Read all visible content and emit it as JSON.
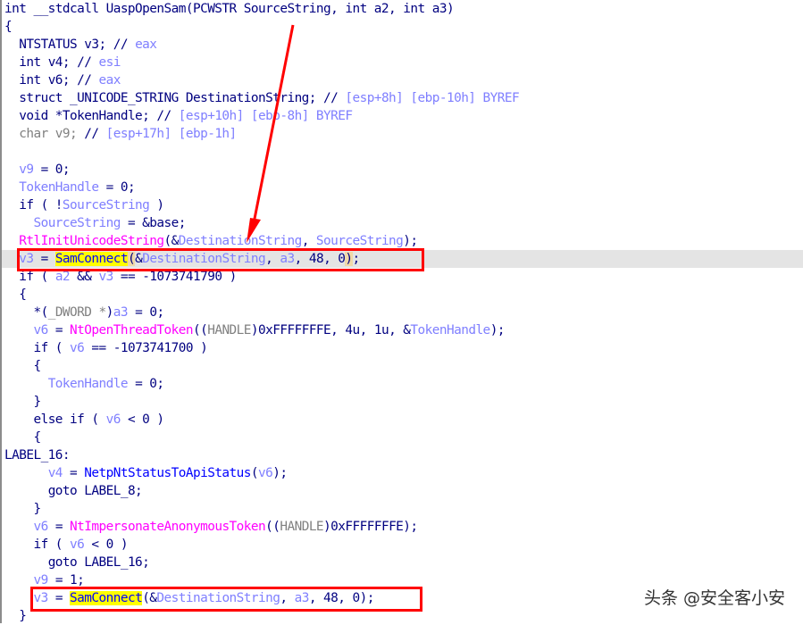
{
  "window": {
    "type": "IDA Pro pseudocode view",
    "function_signature": "int __stdcall UaspOpenSam(PCWSTR SourceString, int a2, int a3)"
  },
  "colors": {
    "keyword": "#000080",
    "variable": "#7f7fff",
    "function_import": "#ff00ff",
    "function_local": "#0000ff",
    "highlight_line": "#e4e4e4",
    "selected_word": "#ffff00",
    "annotation": "#ff0000"
  },
  "lines": [
    {
      "indent": 0,
      "tokens": [
        {
          "c": "t-kw",
          "t": "int __stdcall UaspOpenSam(PCWSTR SourceString, int a2, int a3)"
        }
      ]
    },
    {
      "indent": 0,
      "tokens": [
        {
          "c": "t-kw",
          "t": "{"
        }
      ]
    },
    {
      "indent": 2,
      "tokens": [
        {
          "c": "t-kw",
          "t": "NTSTATUS v3; // "
        },
        {
          "c": "t-cmt",
          "t": "eax"
        }
      ]
    },
    {
      "indent": 2,
      "tokens": [
        {
          "c": "t-kw",
          "t": "int v4; // "
        },
        {
          "c": "t-cmt",
          "t": "esi"
        }
      ]
    },
    {
      "indent": 2,
      "tokens": [
        {
          "c": "t-kw",
          "t": "int v6; // "
        },
        {
          "c": "t-cmt",
          "t": "eax"
        }
      ]
    },
    {
      "indent": 2,
      "tokens": [
        {
          "c": "t-kw",
          "t": "struct _UNICODE_STRING DestinationString; // "
        },
        {
          "c": "t-cmt",
          "t": "[esp+8h] [ebp-10h] BYREF"
        }
      ]
    },
    {
      "indent": 2,
      "tokens": [
        {
          "c": "t-kw",
          "t": "void *TokenHandle; // "
        },
        {
          "c": "t-cmt",
          "t": "[esp+10h] [ebp-8h] BYREF"
        }
      ]
    },
    {
      "indent": 2,
      "tokens": [
        {
          "c": "t-gray",
          "t": "char v9; "
        },
        {
          "c": "t-kw",
          "t": "// "
        },
        {
          "c": "t-cmt",
          "t": "[esp+17h] [ebp-1h]"
        }
      ]
    },
    {
      "indent": 0,
      "tokens": []
    },
    {
      "indent": 2,
      "tokens": [
        {
          "c": "t-var",
          "t": "v9"
        },
        {
          "c": "t-kw",
          "t": " = 0;"
        }
      ]
    },
    {
      "indent": 2,
      "tokens": [
        {
          "c": "t-var",
          "t": "TokenHandle"
        },
        {
          "c": "t-kw",
          "t": " = 0;"
        }
      ]
    },
    {
      "indent": 2,
      "tokens": [
        {
          "c": "t-kw",
          "t": "if ( !"
        },
        {
          "c": "t-var",
          "t": "SourceString"
        },
        {
          "c": "t-kw",
          "t": " )"
        }
      ]
    },
    {
      "indent": 4,
      "tokens": [
        {
          "c": "t-var",
          "t": "SourceString"
        },
        {
          "c": "t-kw",
          "t": " = &base;"
        }
      ]
    },
    {
      "indent": 2,
      "tokens": [
        {
          "c": "t-fn",
          "t": "RtlInitUnicodeString"
        },
        {
          "c": "t-kw",
          "t": "(&"
        },
        {
          "c": "t-var",
          "t": "DestinationString"
        },
        {
          "c": "t-kw",
          "t": ", "
        },
        {
          "c": "t-var",
          "t": "SourceString"
        },
        {
          "c": "t-kw",
          "t": ");"
        }
      ]
    },
    {
      "indent": 2,
      "hl": true,
      "tokens": [
        {
          "c": "t-var",
          "t": "v3"
        },
        {
          "c": "t-kw",
          "t": " = "
        },
        {
          "c": "t-sel",
          "t": "SamConnect"
        },
        {
          "c": "t-kw t-paren",
          "t": "("
        },
        {
          "c": "t-kw",
          "t": "&"
        },
        {
          "c": "t-var",
          "t": "DestinationString"
        },
        {
          "c": "t-kw",
          "t": ", "
        },
        {
          "c": "t-var",
          "t": "a3"
        },
        {
          "c": "t-kw",
          "t": ", 48, 0"
        },
        {
          "c": "t-kw t-paren",
          "t": ")"
        },
        {
          "c": "t-kw",
          "t": ";"
        }
      ]
    },
    {
      "indent": 2,
      "tokens": [
        {
          "c": "t-kw",
          "t": "if ( "
        },
        {
          "c": "t-var",
          "t": "a2"
        },
        {
          "c": "t-kw",
          "t": " && "
        },
        {
          "c": "t-var",
          "t": "v3"
        },
        {
          "c": "t-kw",
          "t": " == -1073741790 )"
        }
      ]
    },
    {
      "indent": 2,
      "tokens": [
        {
          "c": "t-kw",
          "t": "{"
        }
      ]
    },
    {
      "indent": 4,
      "tokens": [
        {
          "c": "t-kw",
          "t": "*("
        },
        {
          "c": "t-gray",
          "t": "_DWORD *"
        },
        {
          "c": "t-kw",
          "t": ")"
        },
        {
          "c": "t-var",
          "t": "a3"
        },
        {
          "c": "t-kw",
          "t": " = 0;"
        }
      ]
    },
    {
      "indent": 4,
      "tokens": [
        {
          "c": "t-var",
          "t": "v6"
        },
        {
          "c": "t-kw",
          "t": " = "
        },
        {
          "c": "t-fn",
          "t": "NtOpenThreadToken"
        },
        {
          "c": "t-kw",
          "t": "(("
        },
        {
          "c": "t-gray",
          "t": "HANDLE"
        },
        {
          "c": "t-kw",
          "t": ")0xFFFFFFFE, 4u, 1u, &"
        },
        {
          "c": "t-var",
          "t": "TokenHandle"
        },
        {
          "c": "t-kw",
          "t": ");"
        }
      ]
    },
    {
      "indent": 4,
      "tokens": [
        {
          "c": "t-kw",
          "t": "if ( "
        },
        {
          "c": "t-var",
          "t": "v6"
        },
        {
          "c": "t-kw",
          "t": " == -1073741700 )"
        }
      ]
    },
    {
      "indent": 4,
      "tokens": [
        {
          "c": "t-kw",
          "t": "{"
        }
      ]
    },
    {
      "indent": 6,
      "tokens": [
        {
          "c": "t-var",
          "t": "TokenHandle"
        },
        {
          "c": "t-kw",
          "t": " = 0;"
        }
      ]
    },
    {
      "indent": 4,
      "tokens": [
        {
          "c": "t-kw",
          "t": "}"
        }
      ]
    },
    {
      "indent": 4,
      "tokens": [
        {
          "c": "t-kw",
          "t": "else if ( "
        },
        {
          "c": "t-var",
          "t": "v6"
        },
        {
          "c": "t-kw",
          "t": " < 0 )"
        }
      ]
    },
    {
      "indent": 4,
      "tokens": [
        {
          "c": "t-kw",
          "t": "{"
        }
      ]
    },
    {
      "indent": 0,
      "tokens": [
        {
          "c": "t-kw",
          "t": "LABEL_16:"
        }
      ]
    },
    {
      "indent": 6,
      "tokens": [
        {
          "c": "t-var",
          "t": "v4"
        },
        {
          "c": "t-kw",
          "t": " = "
        },
        {
          "c": "t-api",
          "t": "NetpNtStatusToApiStatus"
        },
        {
          "c": "t-kw",
          "t": "("
        },
        {
          "c": "t-var",
          "t": "v6"
        },
        {
          "c": "t-kw",
          "t": ");"
        }
      ]
    },
    {
      "indent": 6,
      "tokens": [
        {
          "c": "t-kw",
          "t": "goto LABEL_8;"
        }
      ]
    },
    {
      "indent": 4,
      "tokens": [
        {
          "c": "t-kw",
          "t": "}"
        }
      ]
    },
    {
      "indent": 4,
      "tokens": [
        {
          "c": "t-var",
          "t": "v6"
        },
        {
          "c": "t-kw",
          "t": " = "
        },
        {
          "c": "t-fn",
          "t": "NtImpersonateAnonymousToken"
        },
        {
          "c": "t-kw",
          "t": "(("
        },
        {
          "c": "t-gray",
          "t": "HANDLE"
        },
        {
          "c": "t-kw",
          "t": ")0xFFFFFFFE);"
        }
      ]
    },
    {
      "indent": 4,
      "tokens": [
        {
          "c": "t-kw",
          "t": "if ( "
        },
        {
          "c": "t-var",
          "t": "v6"
        },
        {
          "c": "t-kw",
          "t": " < 0 )"
        }
      ]
    },
    {
      "indent": 6,
      "tokens": [
        {
          "c": "t-kw",
          "t": "goto LABEL_16;"
        }
      ]
    },
    {
      "indent": 4,
      "tokens": [
        {
          "c": "t-var",
          "t": "v9"
        },
        {
          "c": "t-kw",
          "t": " = 1;"
        }
      ]
    },
    {
      "indent": 4,
      "tokens": [
        {
          "c": "t-var",
          "t": "v3"
        },
        {
          "c": "t-kw",
          "t": " = "
        },
        {
          "c": "t-sel",
          "t": "SamConnect"
        },
        {
          "c": "t-kw",
          "t": "(&"
        },
        {
          "c": "t-var",
          "t": "DestinationString"
        },
        {
          "c": "t-kw",
          "t": ", "
        },
        {
          "c": "t-var",
          "t": "a3"
        },
        {
          "c": "t-kw",
          "t": ", 48, 0);"
        }
      ]
    },
    {
      "indent": 2,
      "tokens": [
        {
          "c": "t-kw",
          "t": "}"
        }
      ]
    }
  ],
  "annotations": {
    "highlighted_calls": [
      "SamConnect (first call)",
      "SamConnect (second call)"
    ]
  },
  "watermark": "头条 @安全客小安"
}
